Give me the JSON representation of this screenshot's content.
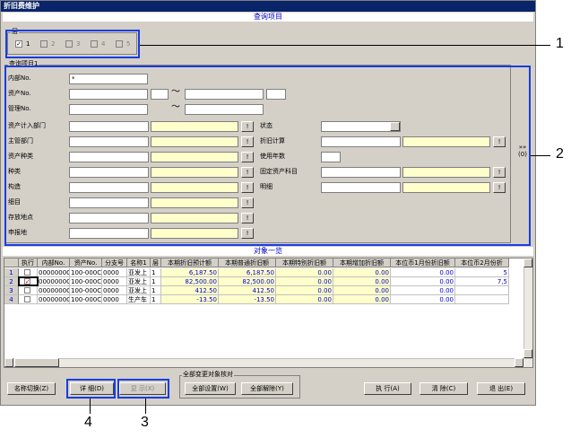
{
  "window": {
    "title": "折旧费维护"
  },
  "query_section": {
    "label": "查询项目"
  },
  "layer": {
    "label": "层",
    "options": [
      {
        "label": "1",
        "checked": true,
        "enabled": true
      },
      {
        "label": "2",
        "checked": false,
        "enabled": false
      },
      {
        "label": "3",
        "checked": false,
        "enabled": false
      },
      {
        "label": "4",
        "checked": false,
        "enabled": false
      },
      {
        "label": "5",
        "checked": false,
        "enabled": false
      }
    ]
  },
  "query_items": {
    "label": "查询项目1",
    "internal_no": {
      "label": "内部No.",
      "value": "*"
    },
    "asset_no": {
      "label": "资产No."
    },
    "manage_no": {
      "label": "管理No."
    },
    "range_symbol": "〜",
    "left_fields": [
      "资产计入部门",
      "主管部门",
      "资产种类",
      "种类",
      "构造",
      "细目",
      "存放地点",
      "申报地"
    ],
    "right_fields": [
      "状态",
      "折旧计算",
      "使用年数",
      "固定资产科目",
      "明细"
    ],
    "lookup_button": "!",
    "expand_button": "»»\n(0)"
  },
  "list_section": {
    "label": "对象一览"
  },
  "grid": {
    "columns": [
      "执行",
      "内部No.",
      "资产No.",
      "分支号",
      "名称1",
      "层",
      "本期折旧预计额",
      "本期普通折旧额",
      "本期特别折旧额",
      "本期增加折旧额",
      "本位币1月份折旧额",
      "本位币2月份折"
    ],
    "rows": [
      {
        "no": "1",
        "checked": false,
        "internal": "0000000C",
        "asset": "100-000C",
        "branch": "0000",
        "name": "亚发上",
        "layer": "1",
        "v1": "6,187.50",
        "v2": "6,187.50",
        "v3": "0.00",
        "v4": "0.00",
        "v5": "0.00",
        "v6": "5"
      },
      {
        "no": "2",
        "checked": true,
        "internal": "0000000C",
        "asset": "100-000C",
        "branch": "0000",
        "name": "亚发上",
        "layer": "1",
        "v1": "82,500.00",
        "v2": "82,500.00",
        "v3": "0.00",
        "v4": "0.00",
        "v5": "0.00",
        "v6": "7,5"
      },
      {
        "no": "3",
        "checked": false,
        "internal": "0000000C",
        "asset": "100-000C",
        "branch": "0000",
        "name": "亚发上",
        "layer": "1",
        "v1": "412.50",
        "v2": "412.50",
        "v3": "0.00",
        "v4": "0.00",
        "v5": "0.00",
        "v6": ""
      },
      {
        "no": "4",
        "checked": false,
        "internal": "0000000C",
        "asset": "100-000C",
        "branch": "0000",
        "name": "生产车",
        "layer": "1",
        "v1": "-13.50",
        "v2": "-13.50",
        "v3": "0.00",
        "v4": "0.00",
        "v5": "0.00",
        "v6": ""
      }
    ]
  },
  "buttons": {
    "name_switch": "名称切换(Z)",
    "detail": "详 细(D)",
    "show": "显 示(X)",
    "change_group": "全部变更对象核对",
    "select_all": "全部设置(W)",
    "clear_all": "全部解除(Y)",
    "execute": "执 行(A)",
    "clear": "清 除(C)",
    "exit": "退 出(E)"
  },
  "callouts": [
    "1",
    "2",
    "3",
    "4"
  ]
}
